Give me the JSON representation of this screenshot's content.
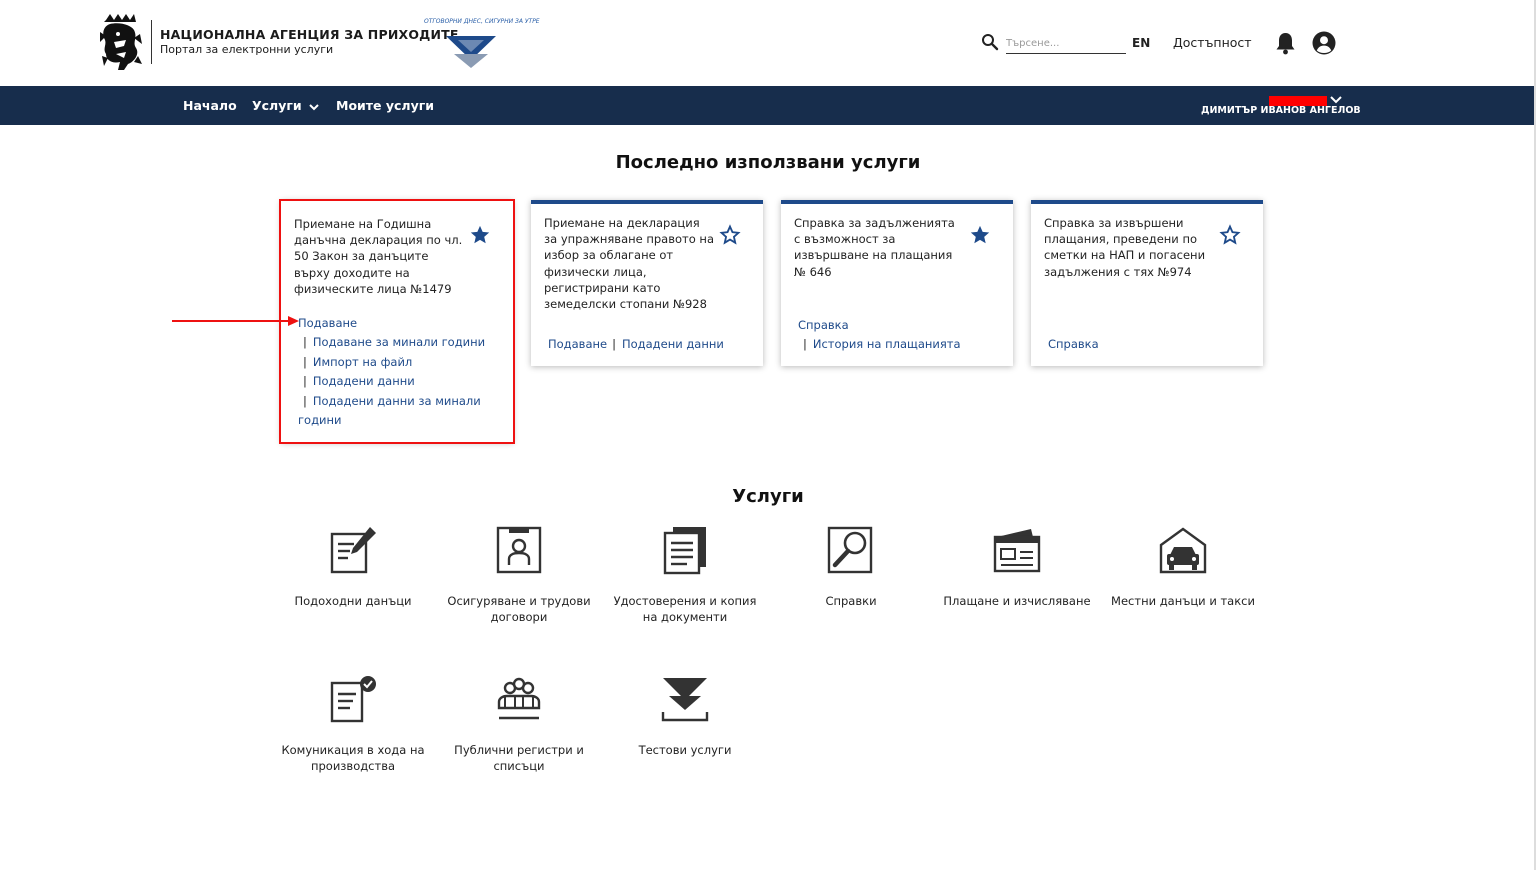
{
  "header": {
    "agency_name": "НАЦИОНАЛНА АГЕНЦИЯ ЗА ПРИХОДИТЕ",
    "portal_name": "Портал за електронни услуги",
    "slogan": "ОТГОВОРНИ ДНЕС, СИГУРНИ ЗА УТРЕ",
    "search_placeholder": "Търсене...",
    "lang": "EN",
    "accessibility": "Достъпност"
  },
  "nav": {
    "items": [
      {
        "label": "Начало"
      },
      {
        "label": "Услуги"
      },
      {
        "label": "Моите услуги"
      }
    ],
    "user_name": "ДИМИТЪР ИВАНОВ АНГЕЛОВ"
  },
  "recent": {
    "title": "Последно използвани услуги",
    "cards": [
      {
        "title": "Приемане на Годишна данъчна декларация по чл. 50 Закон за данъците върху доходите на физическите лица №1479",
        "favorite": true,
        "links": [
          "Подаване",
          "Подаване за минали години",
          "Импорт на файл",
          "Подадени данни",
          "Подадени данни за минали години"
        ]
      },
      {
        "title": "Приемане на декларация за упражняване правото на избор за облагане от физически лица, регистрирани като земеделски стопани №928",
        "favorite": false,
        "links": [
          "Подаване",
          "Подадени данни"
        ]
      },
      {
        "title": "Справка за задълженията с възможност за извършване на плащания № 646",
        "favorite": true,
        "links": [
          "Справка",
          "История на плащанията"
        ]
      },
      {
        "title": "Справка за извършени плащания, преведени по сметки на НАП и погасени задължения с тях №974",
        "favorite": false,
        "links": [
          "Справка"
        ]
      }
    ]
  },
  "services": {
    "title": "Услуги",
    "items": [
      {
        "label": "Подоходни данъци",
        "icon": "income-tax-icon"
      },
      {
        "label": "Осигуряване и трудови договори",
        "icon": "insurance-icon"
      },
      {
        "label": "Удостоверения и копия на документи",
        "icon": "certificates-icon"
      },
      {
        "label": "Справки",
        "icon": "reports-icon"
      },
      {
        "label": "Плащане и изчисляване",
        "icon": "payment-icon"
      },
      {
        "label": "Местни данъци и такси",
        "icon": "local-taxes-icon"
      },
      {
        "label": "Комуникация в хода на производства",
        "icon": "communication-icon"
      },
      {
        "label": "Публични регистри и списъци",
        "icon": "registers-icon"
      },
      {
        "label": "Тестови услуги",
        "icon": "test-services-icon"
      }
    ]
  },
  "colors": {
    "nav_bg": "#172d4c",
    "accent": "#1e4a8a",
    "highlight": "#e11111"
  }
}
